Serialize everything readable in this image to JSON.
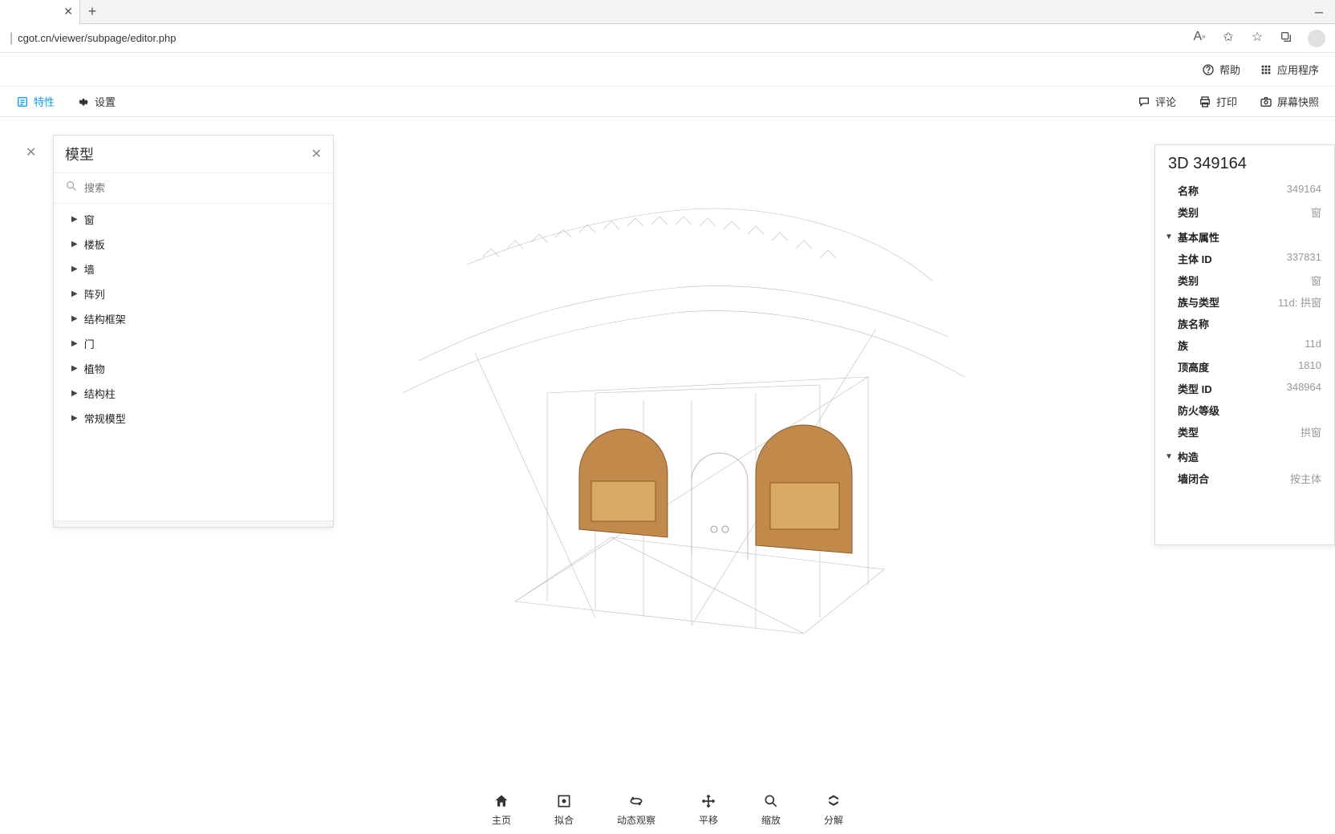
{
  "url": "cgot.cn/viewer/subpage/editor.php",
  "topbar": {
    "help": "帮助",
    "apps": "应用程序"
  },
  "secbar": {
    "props": "特性",
    "settings": "设置",
    "comments": "评论",
    "print": "打印",
    "screenshot": "屏幕快照"
  },
  "left_panel": {
    "title": "模型",
    "search_placeholder": "搜索",
    "items": [
      "窗",
      "楼板",
      "墙",
      "阵列",
      "结构框架",
      "门",
      "植物",
      "结构柱",
      "常规模型"
    ]
  },
  "right_panel": {
    "title": "3D 349164",
    "top": [
      {
        "label": "名称",
        "value": "349164"
      },
      {
        "label": "类别",
        "value": "窗"
      }
    ],
    "section_basic": "基本属性",
    "basic": [
      {
        "label": "主体 ID",
        "value": "337831"
      },
      {
        "label": "类别",
        "value": "窗"
      },
      {
        "label": "族与类型",
        "value": "11d: 拱窗"
      },
      {
        "label": "族名称",
        "value": ""
      },
      {
        "label": "族",
        "value": "11d"
      },
      {
        "label": "顶高度",
        "value": "1810"
      },
      {
        "label": "类型 ID",
        "value": "348964"
      },
      {
        "label": "防火等级",
        "value": ""
      },
      {
        "label": "类型",
        "value": "拱窗"
      }
    ],
    "section_construct": "构造",
    "construct": [
      {
        "label": "墙闭合",
        "value": "按主体"
      }
    ]
  },
  "bottom_bar": {
    "home": "主页",
    "fit": "拟合",
    "orbit": "动态观察",
    "pan": "平移",
    "zoom": "缩放",
    "explode": "分解"
  }
}
